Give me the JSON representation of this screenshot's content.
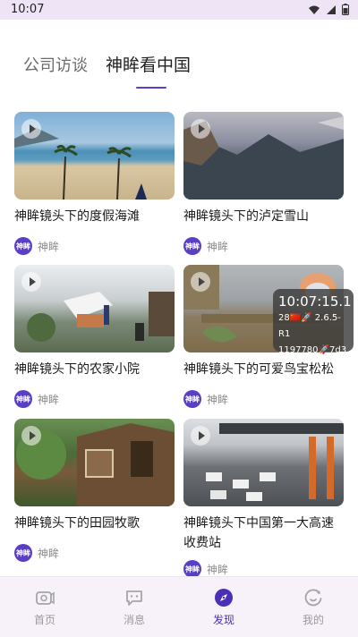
{
  "status": {
    "time": "10:07"
  },
  "tabs": {
    "items": [
      "公司访谈",
      "神眸看中国"
    ],
    "active_index": 1
  },
  "cards": [
    {
      "title": "神眸镜头下的度假海滩",
      "author": "神眸",
      "avatar_text": "神眸"
    },
    {
      "title": "神眸镜头下的泸定雪山",
      "author": "神眸",
      "avatar_text": "神眸"
    },
    {
      "title": "神眸镜头下的农家小院",
      "author": "神眸",
      "avatar_text": "神眸"
    },
    {
      "title": "神眸镜头下的可爱鸟宝松松",
      "author": "神眸",
      "avatar_text": "神眸"
    },
    {
      "title": "神眸镜头下的田园牧歌",
      "author": "神眸",
      "avatar_text": "神眸"
    },
    {
      "title": "神眸镜头下中国第一大高速收费站",
      "author": "神眸",
      "avatar_text": "神眸"
    }
  ],
  "overlay": {
    "line1": "10:07:15.1",
    "line2": "28🇨🇳🚀 2.6.5-R1",
    "line3": "1197780🚀7d3"
  },
  "bottom_nav": {
    "items": [
      {
        "label": "首页",
        "icon": "home-camera-icon"
      },
      {
        "label": "消息",
        "icon": "message-icon"
      },
      {
        "label": "发现",
        "icon": "compass-icon"
      },
      {
        "label": "我的",
        "icon": "profile-icon"
      }
    ],
    "active_index": 2
  },
  "colors": {
    "accent": "#4b30b6",
    "status_bg": "#efe3f6",
    "nav_bg": "#f7f2fa"
  }
}
